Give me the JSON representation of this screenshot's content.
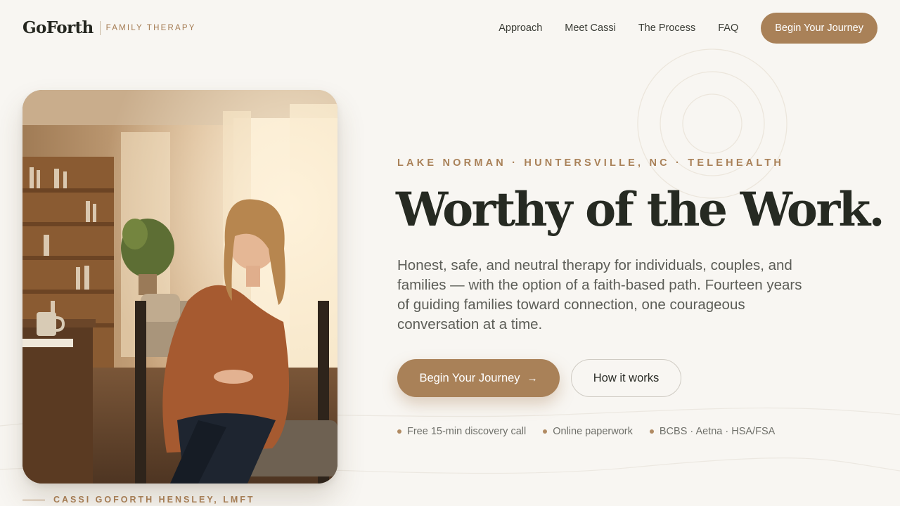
{
  "header": {
    "logo": "GoForth",
    "logo_sub": "FAMILY THERAPY",
    "nav": [
      "Approach",
      "Meet Cassi",
      "The Process",
      "FAQ"
    ],
    "cta": "Begin Your Journey"
  },
  "hero": {
    "eyebrow": "LAKE NORMAN · HUNTERSVILLE, NC · TELEHEALTH",
    "headline": "Worthy of the Work.",
    "lede": "Honest, safe, and neutral therapy for individuals, couples, and families — with the option of a faith-based path. Fourteen years of guiding families toward connection, one courageous conversation at a time.",
    "primary_button": "Begin Your Journey",
    "primary_button_icon": "arrow-right-icon",
    "secondary_button": "How it works",
    "badges": [
      "Free 15-min discovery call",
      "Online paperwork",
      "BCBS · Aetna · HSA/FSA"
    ]
  },
  "photo": {
    "caption": "CASSI GOFORTH HENSLEY, LMFT"
  },
  "colors": {
    "accent": "#a98158",
    "background": "#f8f6f2",
    "heading": "#262a22"
  }
}
